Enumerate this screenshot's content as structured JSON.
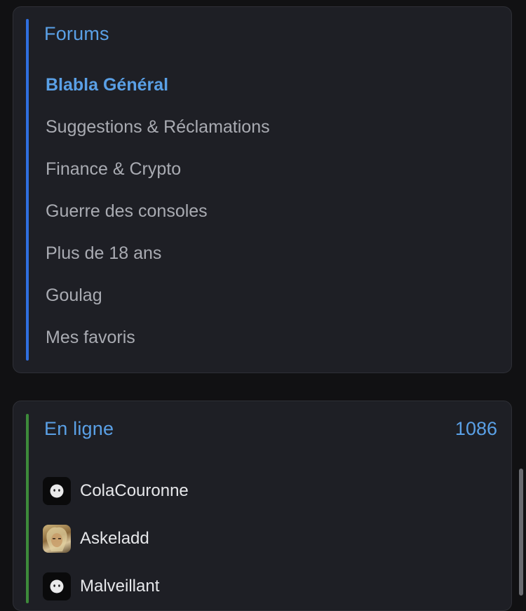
{
  "forums": {
    "title": "Forums",
    "items": [
      {
        "label": "Blabla Général",
        "active": true
      },
      {
        "label": "Suggestions & Réclamations",
        "active": false
      },
      {
        "label": "Finance & Crypto",
        "active": false
      },
      {
        "label": "Guerre des consoles",
        "active": false
      },
      {
        "label": "Plus de 18 ans",
        "active": false
      },
      {
        "label": "Goulag",
        "active": false
      },
      {
        "label": "Mes favoris",
        "active": false
      }
    ]
  },
  "online": {
    "title": "En ligne",
    "count": "1086",
    "users": [
      {
        "name": "ColaCouronne",
        "avatar": "default-face-icon"
      },
      {
        "name": "Askeladd",
        "avatar": "user-photo"
      },
      {
        "name": "Malveillant",
        "avatar": "default-face-icon"
      }
    ]
  },
  "colors": {
    "accent_blue": "#5aa0e6",
    "forums_bar": "#2f6fe0",
    "online_bar": "#3d8a3a",
    "card_bg": "#1e1f25",
    "page_bg": "#111113"
  }
}
